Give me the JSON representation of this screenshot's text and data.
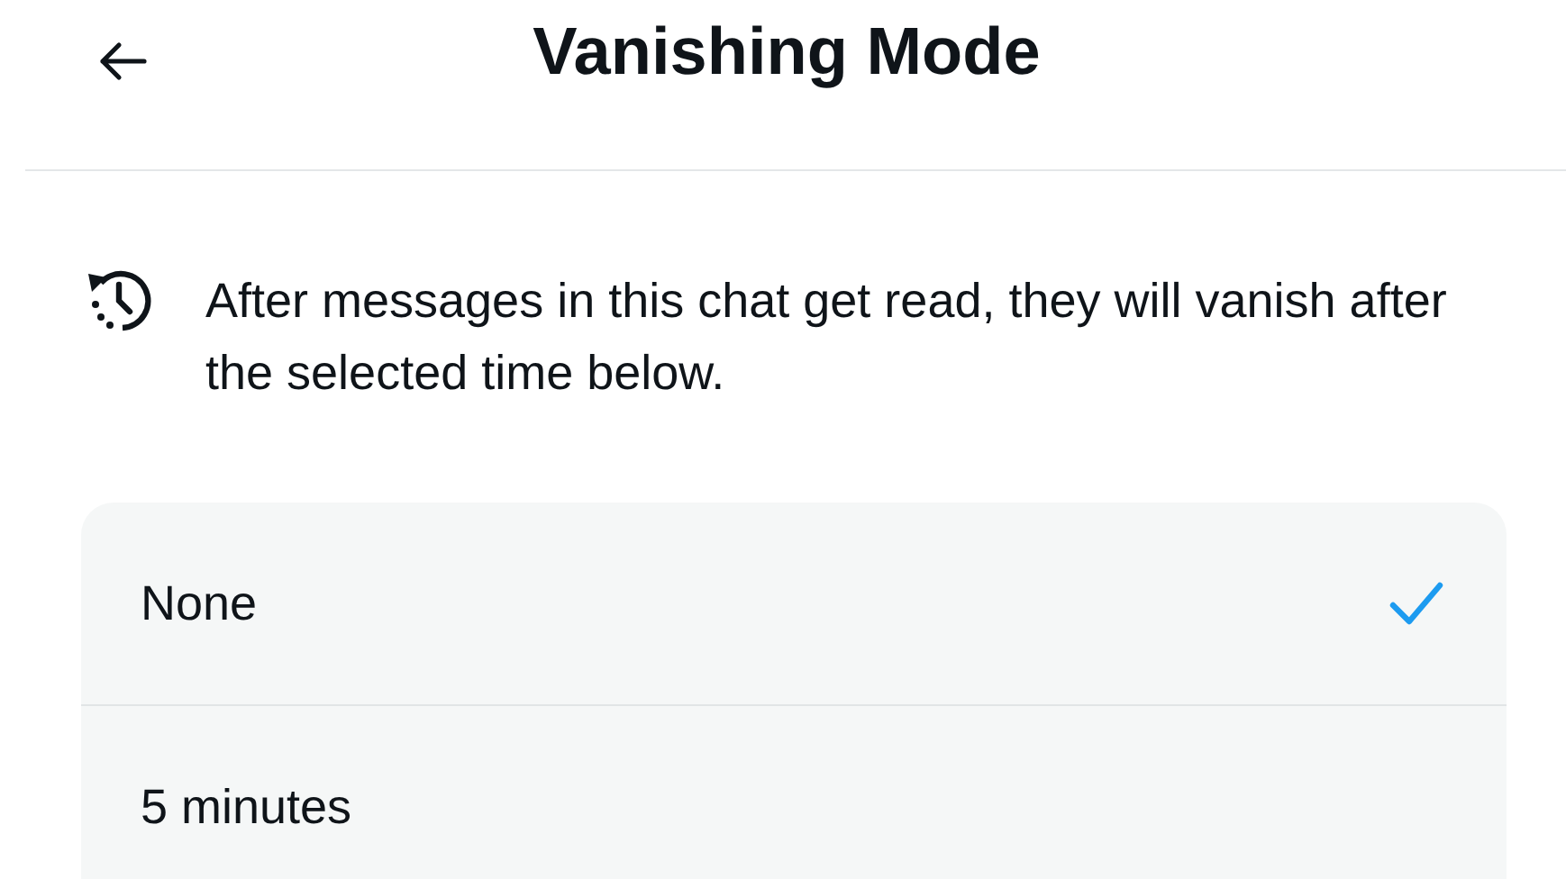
{
  "header": {
    "title": "Vanishing Mode"
  },
  "info": {
    "text": "After messages in this chat get read, they will vanish after the selected time below."
  },
  "options": [
    {
      "label": "None",
      "selected": true
    },
    {
      "label": "5 minutes",
      "selected": false
    }
  ]
}
